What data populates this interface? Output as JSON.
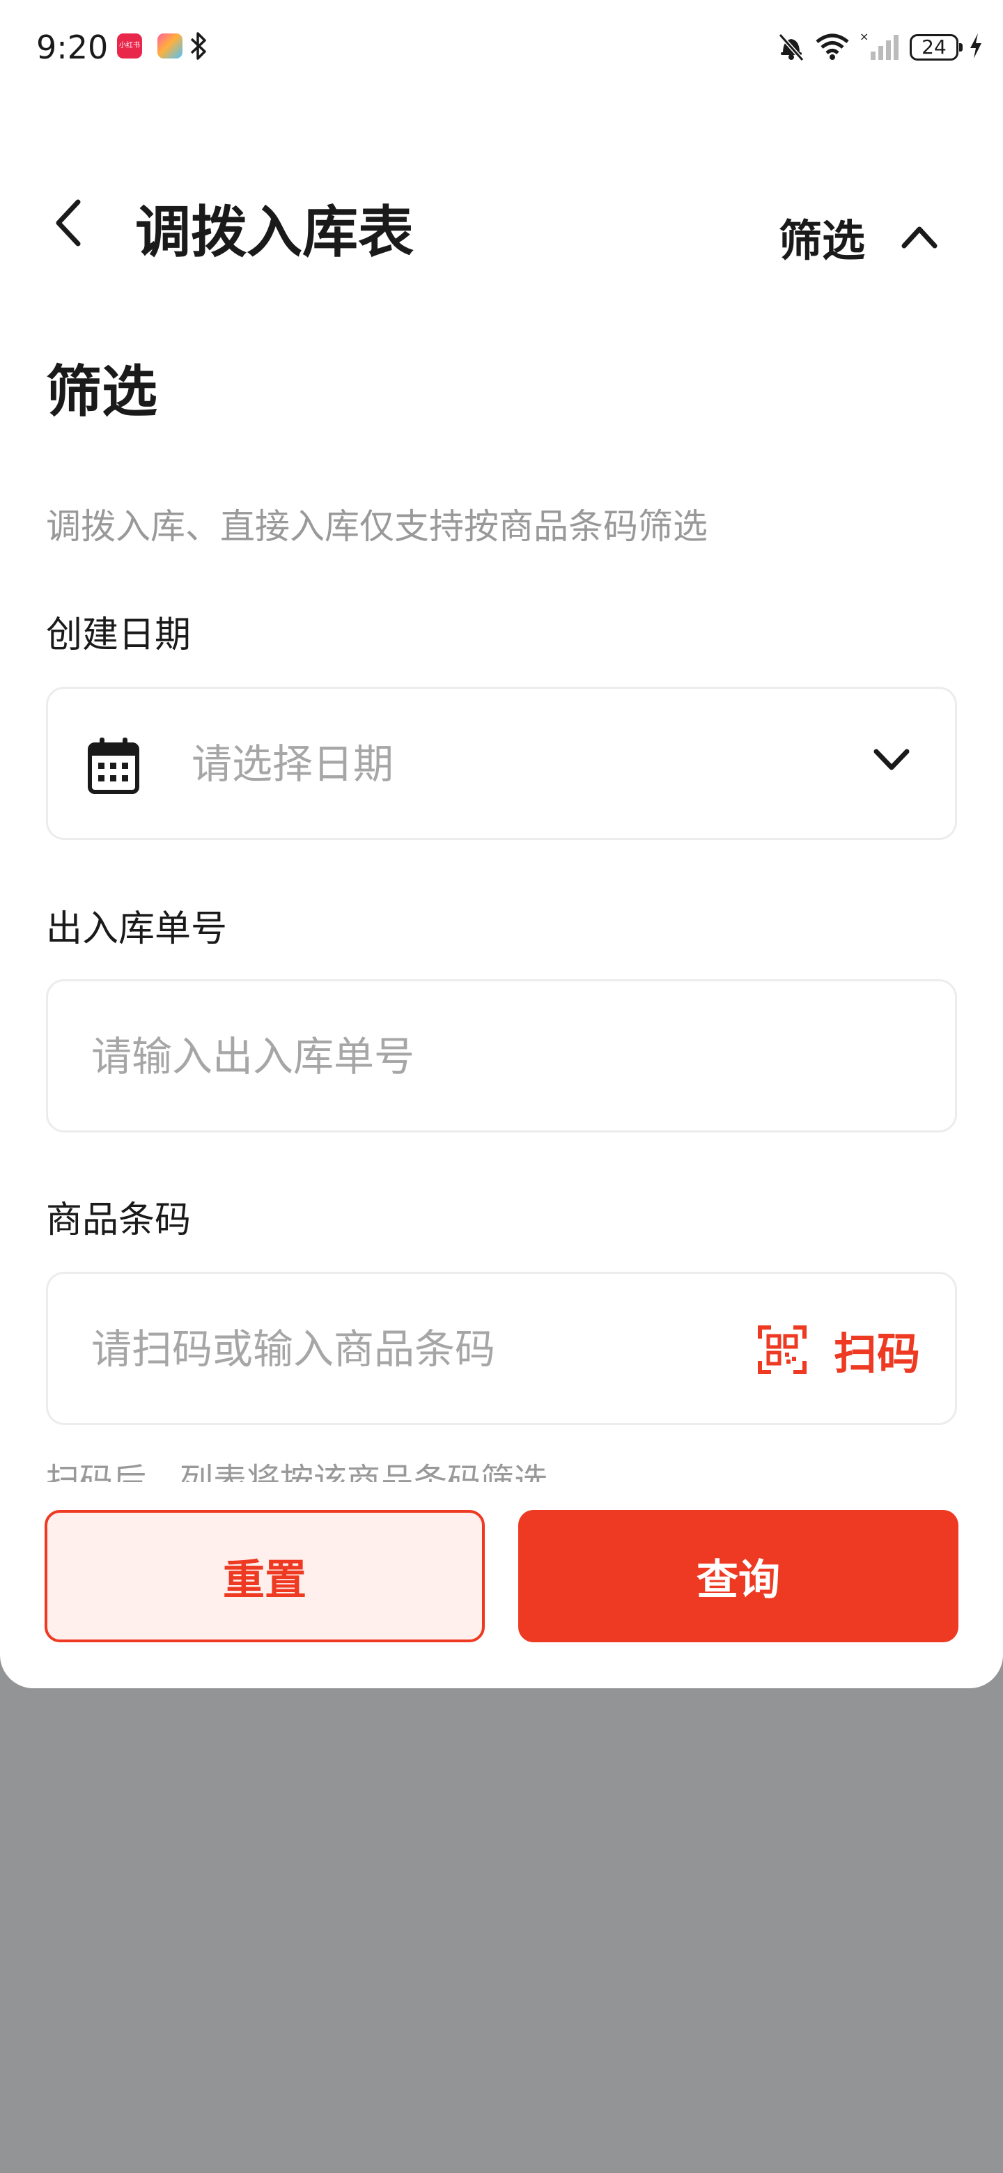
{
  "status_bar": {
    "time": "9:20",
    "app1_label": "小红书",
    "battery": "24",
    "icons": [
      "bluetooth-icon",
      "mute-bell-icon",
      "wifi-icon",
      "signal-icon",
      "battery-icon",
      "charging-icon"
    ]
  },
  "header": {
    "title": "调拨入库表",
    "filter_label": "筛选"
  },
  "filter": {
    "section_title": "筛选",
    "notice": "调拨入库、直接入库仅支持按商品条码筛选",
    "date": {
      "label": "创建日期",
      "placeholder": "请选择日期"
    },
    "order_no": {
      "label": "出入库单号",
      "placeholder": "请输入出入库单号"
    },
    "barcode": {
      "label": "商品条码",
      "placeholder": "请扫码或输入商品条码",
      "scan_label": "扫码"
    },
    "hint": "扫码后，列表将按该商品条码筛选"
  },
  "actions": {
    "reset_label": "重置",
    "query_label": "查询"
  },
  "colors": {
    "accent": "#ee3a22",
    "reset_bg": "#fff0ee",
    "overlay": "#939496"
  }
}
